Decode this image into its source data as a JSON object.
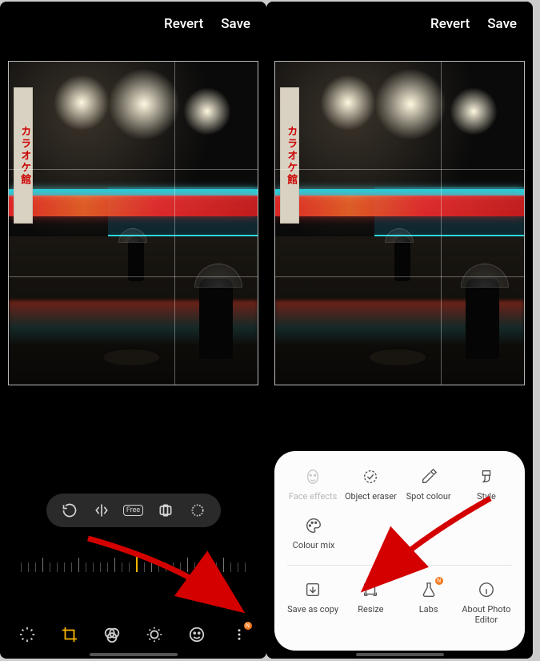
{
  "left": {
    "header": {
      "revert": "Revert",
      "save": "Save"
    },
    "photo_sign": "カラオケ館",
    "crop_tools": {
      "rotate": "rotate",
      "flip": "flip",
      "free": "Free",
      "aspect": "aspect",
      "perspective": "perspective"
    },
    "nav": {
      "auto": "auto",
      "crop": "crop",
      "filters": "filters",
      "adjust": "adjust",
      "stickers": "stickers",
      "more": "more",
      "badge": "N"
    }
  },
  "right": {
    "header": {
      "revert": "Revert",
      "save": "Save"
    },
    "photo_sign": "カラオケ館",
    "sheet": {
      "row1": {
        "face_effects": "Face effects",
        "object_eraser": "Object eraser",
        "spot_colour": "Spot colour",
        "style": "Style"
      },
      "row2": {
        "colour_mix": "Colour mix"
      },
      "row3": {
        "save_as_copy": "Save as copy",
        "resize": "Resize",
        "labs": "Labs",
        "about": "About Photo Editor",
        "labs_badge": "N"
      }
    }
  }
}
